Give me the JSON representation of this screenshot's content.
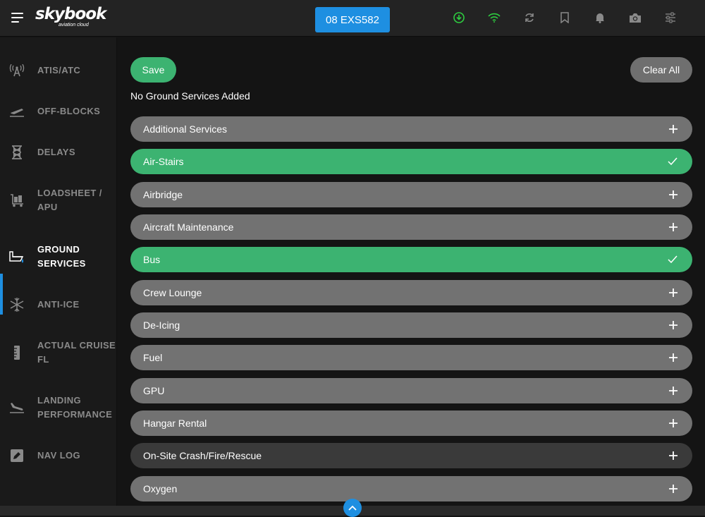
{
  "header": {
    "logo_text": "skybook",
    "logo_tagline": "aviation cloud",
    "flight_label": "08 EXS582"
  },
  "top_icons": [
    {
      "name": "download-icon",
      "color": "#2ecc40"
    },
    {
      "name": "wifi-icon",
      "color": "#2ecc40"
    },
    {
      "name": "sync-icon",
      "color": "#8a8a8a"
    },
    {
      "name": "bookmark-icon",
      "color": "#8a8a8a"
    },
    {
      "name": "bell-icon",
      "color": "#8a8a8a"
    },
    {
      "name": "camera-icon",
      "color": "#8a8a8a"
    },
    {
      "name": "settings-sliders-icon",
      "color": "#8a8a8a"
    }
  ],
  "sidebar": {
    "items": [
      {
        "label": "ATIS/ATC",
        "icon": "radio-tower-icon"
      },
      {
        "label": "OFF-BLOCKS",
        "icon": "takeoff-icon"
      },
      {
        "label": "DELAYS",
        "icon": "hourglass-icon"
      },
      {
        "label": "LOADSHEET /\nAPU",
        "icon": "luggage-cart-icon"
      },
      {
        "label": "GROUND\nSERVICES",
        "icon": "fuel-truck-icon"
      },
      {
        "label": "ANTI-ICE",
        "icon": "snowflake-icon"
      },
      {
        "label": "ACTUAL CRUISE\nFL",
        "icon": "ruler-icon"
      },
      {
        "label": "LANDING\nPERFORMANCE",
        "icon": "landing-icon"
      },
      {
        "label": "NAV LOG",
        "icon": "edit-icon"
      }
    ],
    "active_index": 4
  },
  "main": {
    "save_label": "Save",
    "clear_label": "Clear All",
    "status_text": "No Ground Services Added",
    "services": [
      {
        "label": "Additional Services",
        "state": "add"
      },
      {
        "label": "Air-Stairs",
        "state": "selected"
      },
      {
        "label": "Airbridge",
        "state": "add"
      },
      {
        "label": "Aircraft Maintenance",
        "state": "add"
      },
      {
        "label": "Bus",
        "state": "selected"
      },
      {
        "label": "Crew Lounge",
        "state": "add"
      },
      {
        "label": "De-Icing",
        "state": "add"
      },
      {
        "label": "Fuel",
        "state": "add"
      },
      {
        "label": "GPU",
        "state": "add"
      },
      {
        "label": "Hangar Rental",
        "state": "add"
      },
      {
        "label": "On-Site Crash/Fire/Rescue",
        "state": "disabled"
      },
      {
        "label": "Oxygen",
        "state": "add"
      }
    ]
  },
  "colors": {
    "accent_blue": "#1e8fe1",
    "selected_green": "#3cb371",
    "row_grey": "#727272",
    "row_dark": "#3a3a3a"
  }
}
